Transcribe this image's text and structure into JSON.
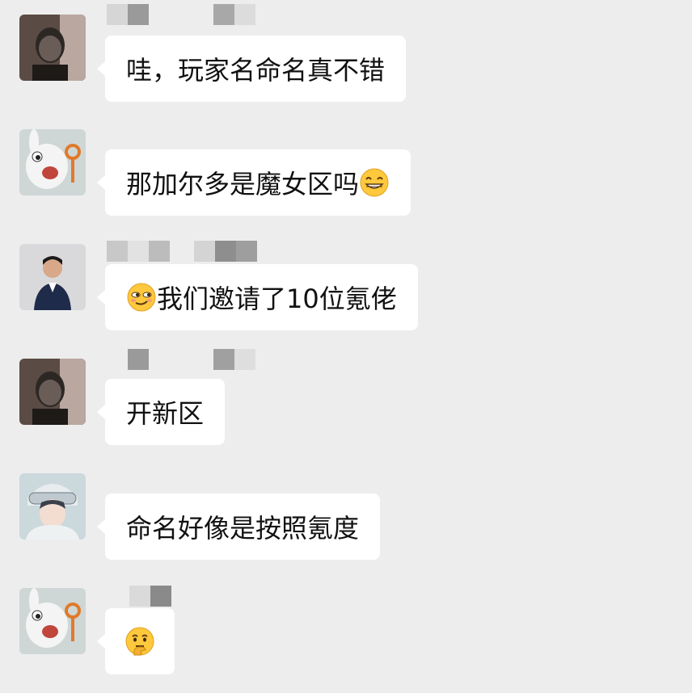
{
  "messages": [
    {
      "sender_avatar": "man-dark-photo-avatar",
      "text": "哇，玩家名命名真不错",
      "emoji_before": "",
      "emoji_after": ""
    },
    {
      "sender_avatar": "white-rabbit-avatar",
      "text": "那加尔多是魔女区吗",
      "emoji_before": "",
      "emoji_after": "grinning-face-emoji"
    },
    {
      "sender_avatar": "man-suit-avatar",
      "text": "我们邀请了10位氪佬",
      "emoji_before": "smirk-face-emoji",
      "emoji_after": ""
    },
    {
      "sender_avatar": "man-dark-photo-avatar",
      "text": "开新区",
      "emoji_before": "",
      "emoji_after": ""
    },
    {
      "sender_avatar": "anime-goggles-avatar",
      "text": "命名好像是按照氪度",
      "emoji_before": "",
      "emoji_after": ""
    },
    {
      "sender_avatar": "white-rabbit-avatar",
      "text": "",
      "emoji_before": "",
      "emoji_after": "thinking-face-emoji"
    }
  ],
  "colors": {
    "background": "#ededed",
    "bubble": "#ffffff",
    "text": "#111111"
  }
}
